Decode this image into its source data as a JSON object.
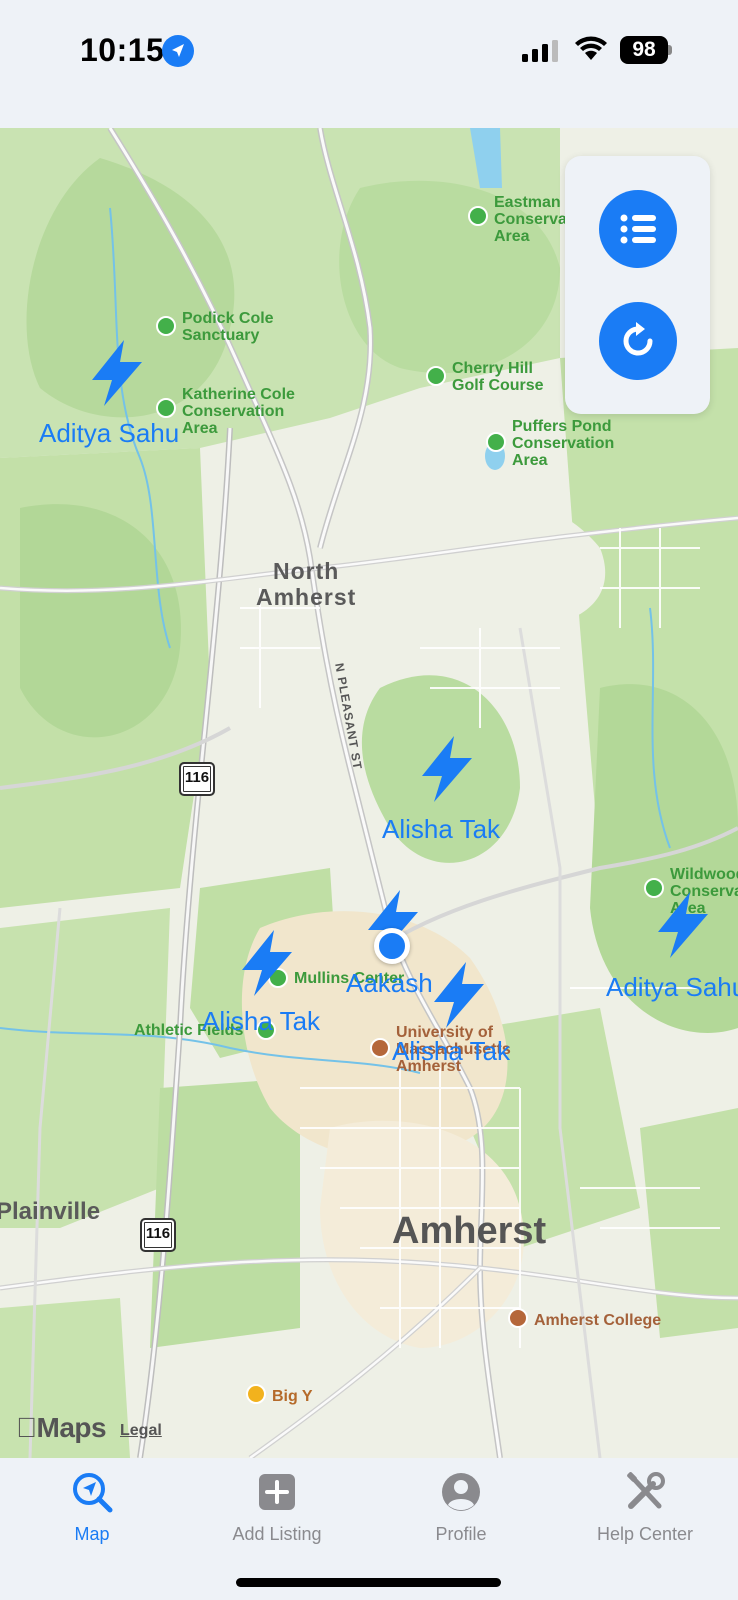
{
  "status_bar": {
    "time": "10:15",
    "battery": "98"
  },
  "map": {
    "pois": [
      {
        "key": "eastman",
        "text": "Eastman\nConservation\nArea"
      },
      {
        "key": "podick",
        "text": "Podick Cole\nSanctuary"
      },
      {
        "key": "katherine",
        "text": "Katherine Cole\nConservation\nArea"
      },
      {
        "key": "cherry",
        "text": "Cherry Hill\nGolf Course"
      },
      {
        "key": "puffers",
        "text": "Puffers Pond\nConservation\nArea"
      },
      {
        "key": "wildwood",
        "text": "Wildwood\nConservation\nArea"
      },
      {
        "key": "mullins",
        "text": "Mullins Center"
      },
      {
        "key": "athletic",
        "text": "Athletic Fields"
      },
      {
        "key": "umass",
        "text": "University of\nMassachusetts\nAmherst"
      },
      {
        "key": "amherst_college",
        "text": "Amherst College"
      },
      {
        "key": "bigy",
        "text": "Big Y"
      }
    ],
    "towns": {
      "north_amherst": "North\nAmherst",
      "amherst": "Amherst",
      "plainville": "Plainville"
    },
    "street": "N PLEASANT ST",
    "route_shields": [
      "116",
      "116"
    ],
    "markers": [
      {
        "label": "Aditya Sahu"
      },
      {
        "label": "Alisha Tak"
      },
      {
        "label": "Aditya Sahu"
      },
      {
        "label": "Aakash"
      },
      {
        "label": "Alisha Tak"
      },
      {
        "label": "Alisha Tak"
      }
    ],
    "attribution": "Maps",
    "legal": "Legal"
  },
  "controls": {
    "list_icon": "list-icon",
    "refresh_icon": "refresh-icon"
  },
  "tab_bar": {
    "tabs": [
      {
        "label": "Map",
        "icon": "map-search-icon",
        "active": true
      },
      {
        "label": "Add Listing",
        "icon": "plus-square-icon",
        "active": false
      },
      {
        "label": "Profile",
        "icon": "person-circle-icon",
        "active": false
      },
      {
        "label": "Help Center",
        "icon": "tools-icon",
        "active": false
      }
    ]
  },
  "colors": {
    "accent": "#1a7cf5",
    "park_green": "#43b04a"
  }
}
